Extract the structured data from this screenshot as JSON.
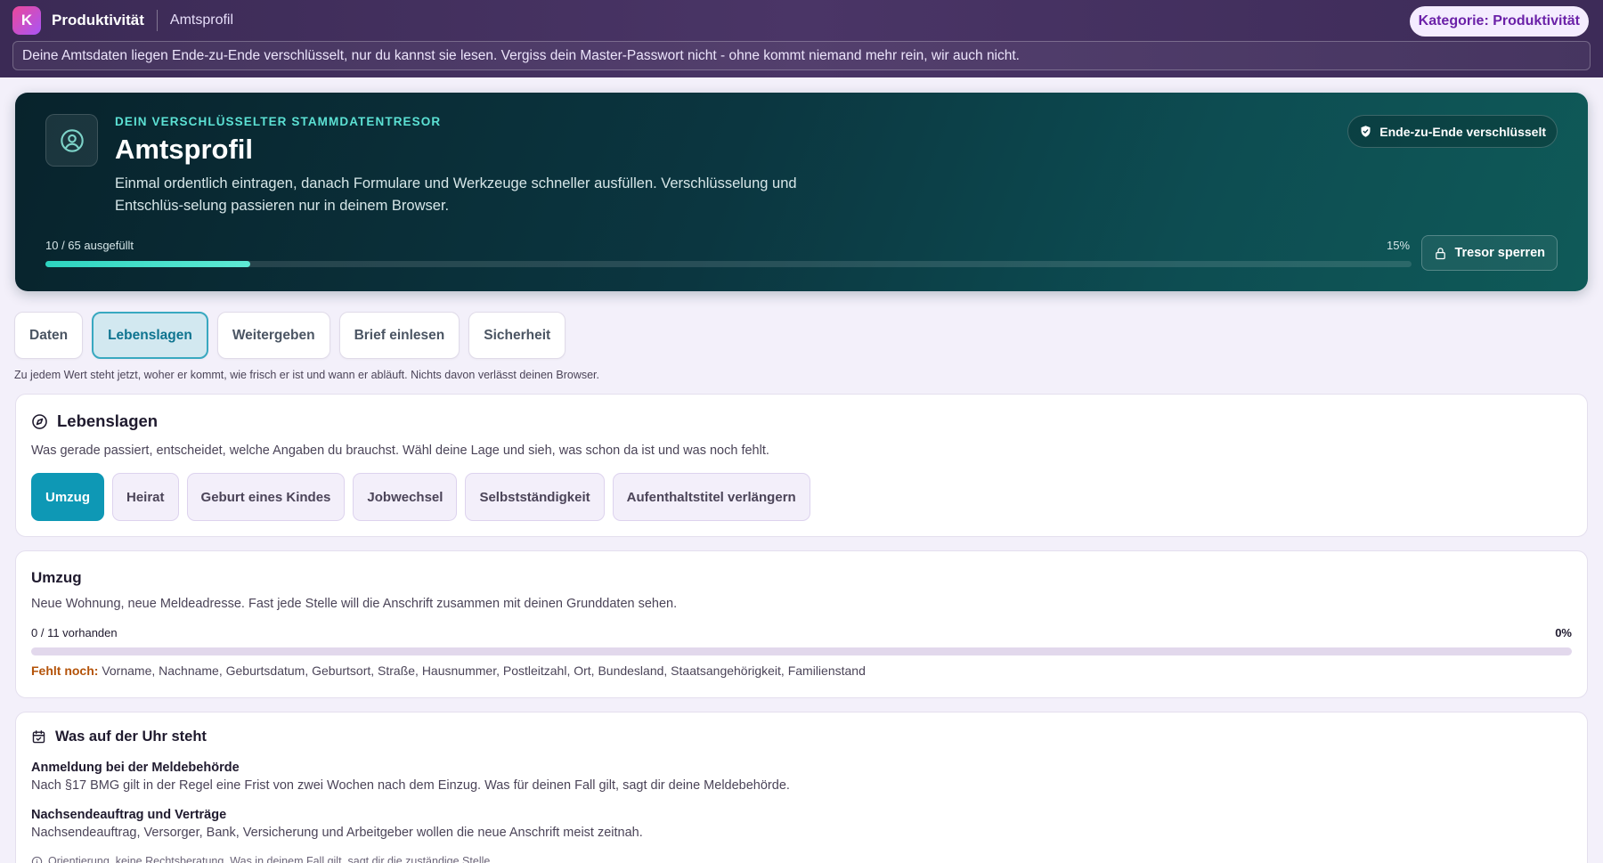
{
  "topbar": {
    "logo_letter": "K",
    "app_name": "Produktivität",
    "page": "Amtsprofil",
    "category": "Kategorie: Produktivität",
    "notice": "Deine Amtsdaten liegen Ende-zu-Ende verschlüsselt, nur du kannst sie lesen. Vergiss dein Master-Passwort nicht - ohne kommt niemand mehr rein, wir auch nicht."
  },
  "hero": {
    "icon": "user-circle-icon",
    "eyebrow": "DEIN VERSCHLÜSSELTER STAMMDATENTRESOR",
    "title": "Amtsprofil",
    "description": "Einmal ordentlich eintragen, danach Formulare und Werkzeuge schneller ausfüllen. Verschlüsselung und Entschlüs-selung passieren nur in deinem Browser.",
    "badge": "Ende-zu-Ende verschlüsselt",
    "progress_label": "10 / 65 ausgefüllt",
    "progress_pct_label": "15%",
    "progress_fraction": 0.15,
    "lock_button": "Tresor sperren"
  },
  "tabs": {
    "items": [
      "Daten",
      "Lebenslagen",
      "Weitergeben",
      "Brief einlesen",
      "Sicherheit"
    ],
    "active": "Lebenslagen",
    "hint": "Zu jedem Wert steht jetzt, woher er kommt, wie frisch er ist und wann er abläuft. Nichts davon verlässt deinen Browser."
  },
  "lebenslagen": {
    "title": "Lebenslagen",
    "description": "Was gerade passiert, entscheidet, welche Angaben du brauchst. Wähl deine Lage und sieh, was schon da ist und was noch fehlt.",
    "chips": [
      "Umzug",
      "Heirat",
      "Geburt eines Kindes",
      "Jobwechsel",
      "Selbstständigkeit",
      "Aufenthaltstitel verlängern"
    ],
    "active_chip": "Umzug"
  },
  "umzug": {
    "title": "Umzug",
    "description": "Neue Wohnung, neue Meldeadresse. Fast jede Stelle will die Anschrift zusammen mit deinen Grunddaten sehen.",
    "count_label": "0 / 11 vorhanden",
    "pct_label": "0%",
    "progress_fraction": 0.0,
    "missing_label": "Fehlt noch:",
    "missing_items": "Vorname, Nachname, Geburtsdatum, Geburtsort, Straße, Hausnummer, Postleitzahl, Ort, Bundesland, Staatsangehörigkeit, Familienstand"
  },
  "deadlines": {
    "title": "Was auf der Uhr steht",
    "items": [
      {
        "title": "Anmeldung bei der Meldebehörde",
        "text": "Nach §17 BMG gilt in der Regel eine Frist von zwei Wochen nach dem Einzug. Was für deinen Fall gilt, sagt dir deine Meldebehörde."
      },
      {
        "title": "Nachsendeauftrag und Verträge",
        "text": "Nachsendeauftrag, Versorger, Bank, Versicherung und Arbeitgeber wollen die neue Anschrift meist zeitnah."
      }
    ],
    "disclaimer": "Orientierung, keine Rechtsberatung. Was in deinem Fall gilt, sagt dir die zuständige Stelle."
  },
  "colors": {
    "accent": "#0e98b5",
    "hero_bg": "#0b3640",
    "topbar_bg": "#3b2a55",
    "missing": "#b45309"
  }
}
